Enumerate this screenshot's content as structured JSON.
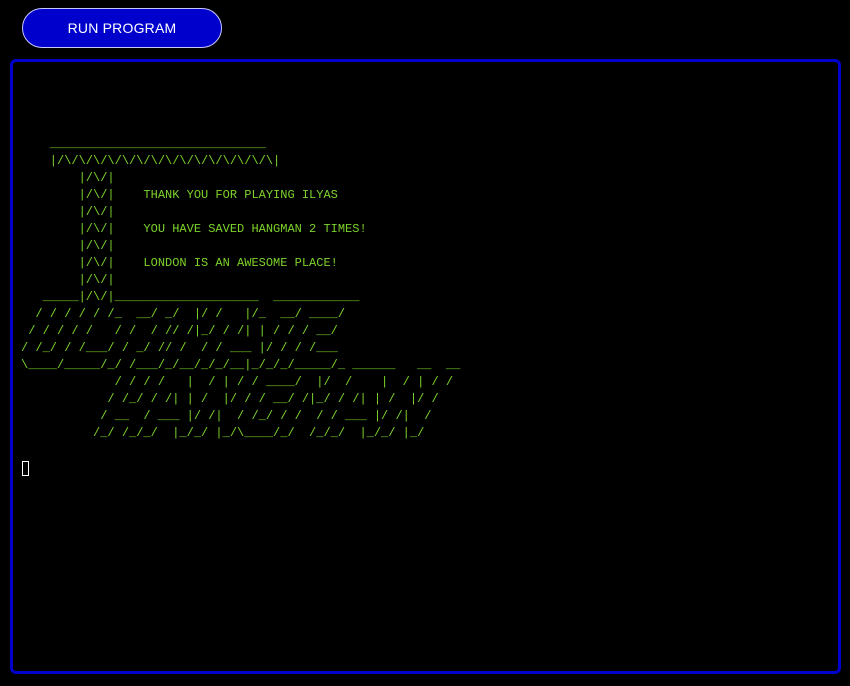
{
  "toolbar": {
    "run_label": "RUN PROGRAM"
  },
  "terminal": {
    "output": "    ______________________________\n    |/\\/\\/\\/\\/\\/\\/\\/\\/\\/\\/\\/\\/\\/\\/\\|\n        |/\\/|\n        |/\\/|    THANK YOU FOR PLAYING ILYAS\n        |/\\/|\n        |/\\/|    YOU HAVE SAVED HANGMAN 2 TIMES!\n        |/\\/|\n        |/\\/|    LONDON IS AN AWESOME PLACE!\n        |/\\/|\n   _____|/\\/|____________________  ____________\n  / / / / / /_  __/ _/  |/ /   |/_  __/ ____/\n / / / / /   / /  / // /|_/ / /| | / / / __/\n/ /_/ / /___/ / _/ // /  / / ___ |/ / / /___\n\\____/_____/_/ /___/_/__/_/_/__|_/_/_/_____/_ ______   __  __\n             / / / /   |  / | / / ____/  |/  /    |  / | / /\n            / /_/ / /| | /  |/ / / __/ /|_/ / /| | /  |/ /\n           / __  / ___ |/ /|  / /_/ / /  / / ___ |/ /|  /\n          /_/ /_/_/  |_/_/ |_/\\____/_/  /_/_/  |_/_/ |_/",
    "text_color": "#7cd32a",
    "border_color": "#0000cd"
  }
}
